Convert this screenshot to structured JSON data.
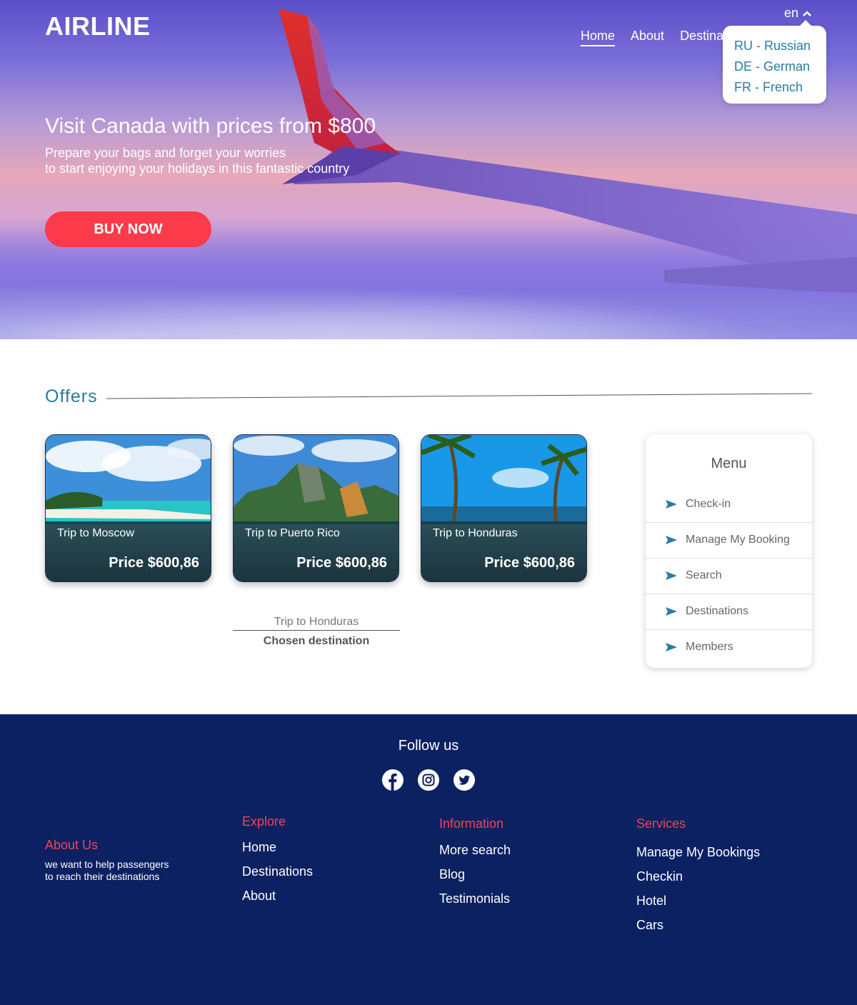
{
  "header": {
    "logo": "AIRLINE",
    "nav": [
      "Home",
      "About",
      "Destina"
    ],
    "language": "en",
    "language_options": [
      "RU - Russian",
      "DE - German",
      "FR - French"
    ]
  },
  "hero": {
    "title": "Visit Canada with prices from $800",
    "subtitle_line1": "Prepare your bags and forget your worries",
    "subtitle_line2": "to start enjoying your holidays in this fantastic country",
    "cta": "BUY NOW"
  },
  "offers": {
    "title": "Offers",
    "cards": [
      {
        "name": "Trip to Moscow",
        "price": "Price $600,86"
      },
      {
        "name": "Trip to Puerto Rico",
        "price": "Price $600,86"
      },
      {
        "name": "Trip to Honduras",
        "price": "Price $600,86"
      }
    ],
    "chosen_value": "Trip to Honduras",
    "chosen_label": "Chosen destination"
  },
  "menu": {
    "title": "Menu",
    "items": [
      "Check-in",
      "Manage My Booking",
      "Search",
      "Destinations",
      "Members"
    ]
  },
  "footer": {
    "follow": "Follow us",
    "social": [
      "facebook-icon",
      "instagram-icon",
      "twitter-icon"
    ],
    "about": {
      "heading": "About Us",
      "text_line1": "we want to help passengers",
      "text_line2": "to reach their destinations"
    },
    "explore": {
      "heading": "Explore",
      "links": [
        "Home",
        "Destinations",
        "About"
      ]
    },
    "information": {
      "heading": "Information",
      "links": [
        "More search",
        "Blog",
        "Testimonials"
      ]
    },
    "services": {
      "heading": "Services",
      "links": [
        "Manage My Bookings",
        "Checkin",
        "Hotel",
        "Cars"
      ]
    }
  },
  "colors": {
    "accent": "#fb3b4a",
    "link_blue": "#2a7ca0",
    "footer_bg": "#0c2162",
    "footer_heading": "#f04455"
  }
}
